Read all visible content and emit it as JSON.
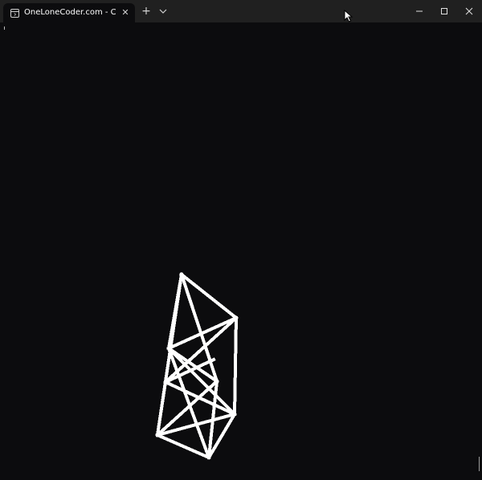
{
  "titlebar": {
    "tab_title": "OneLoneCoder.com - Console",
    "tab_close_glyph": "✕",
    "new_tab_glyph": "+",
    "dropdown_icon": "chevron-down-icon",
    "controls": [
      "minimize-icon",
      "maximize-icon",
      "close-icon"
    ]
  },
  "terminal": {
    "content": "wireframe-3d-polyhedron",
    "colors": {
      "background": "#0c0c0e",
      "wireframe": "#ffffff",
      "titlebar": "#202020"
    }
  }
}
